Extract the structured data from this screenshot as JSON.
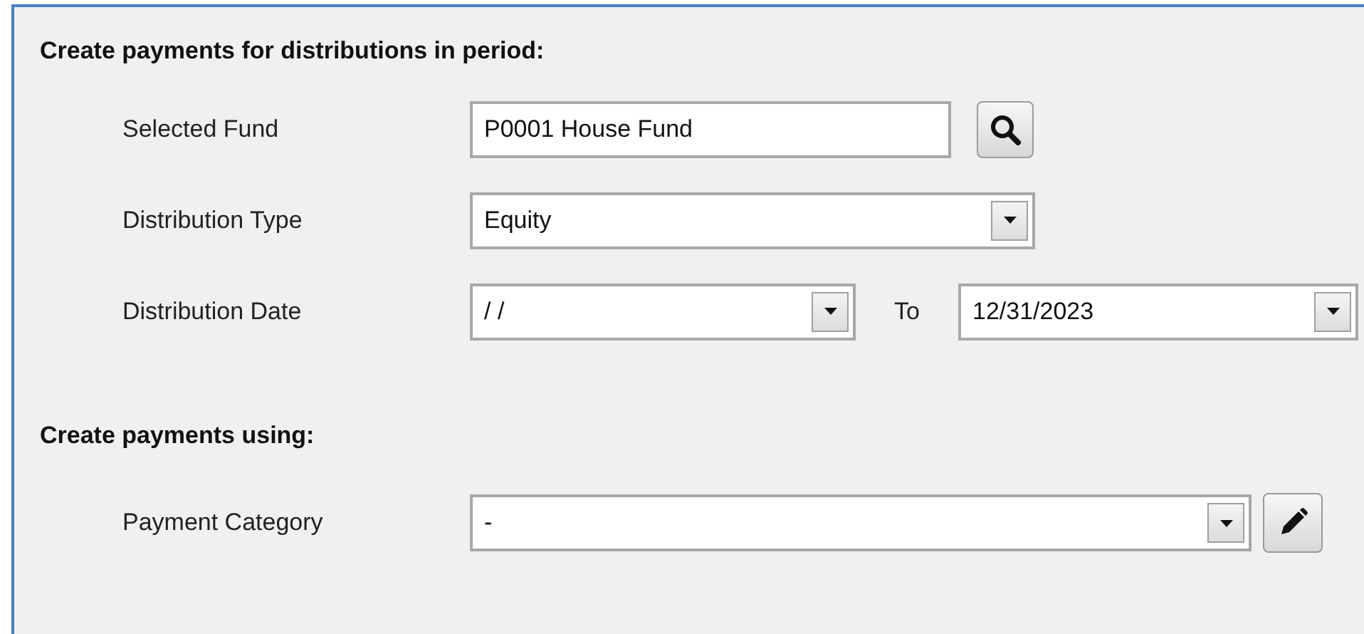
{
  "sections": [
    {
      "heading": "Create payments for distributions in period:",
      "rows": [
        {
          "kind": "lookup",
          "label": "Selected Fund",
          "value": "P0001 House Fund"
        },
        {
          "kind": "dropdown",
          "label": "Distribution Type",
          "value": "Equity"
        },
        {
          "kind": "daterange",
          "label": "Distribution Date",
          "value": "/  /",
          "to_label": "To",
          "to_value": "12/31/2023"
        }
      ]
    },
    {
      "heading": "Create payments using:",
      "rows": [
        {
          "kind": "editdropdown",
          "label": "Payment Category",
          "value": "-"
        }
      ]
    }
  ]
}
